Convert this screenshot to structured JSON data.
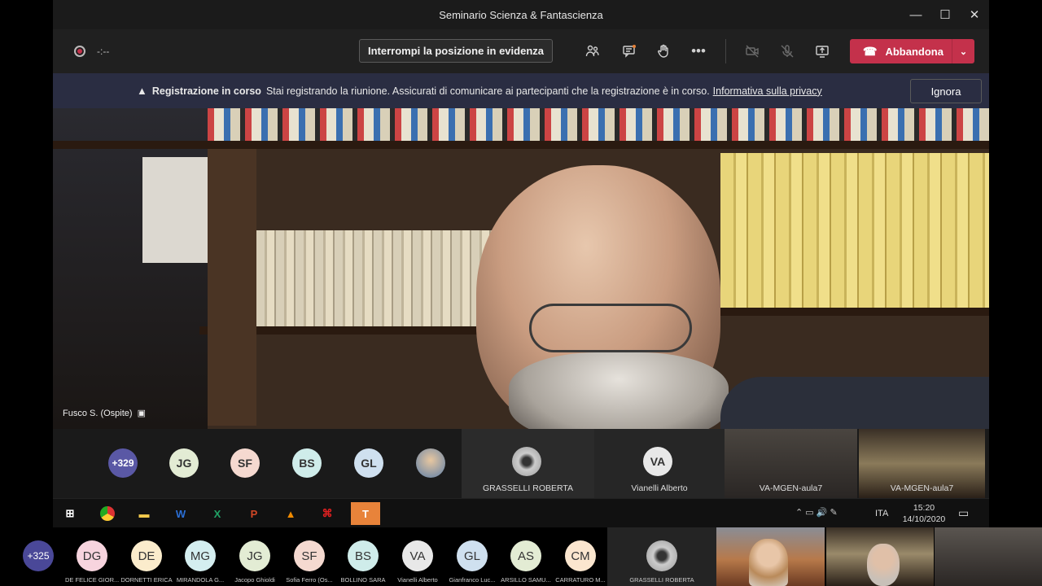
{
  "window": {
    "title": "Seminario Scienza & Fantascienza",
    "minimize": "—",
    "maximize": "☐",
    "close": "✕"
  },
  "toolbar": {
    "rec_time": "-:--",
    "spotlight_label": "Interrompi la posizione in evidenza",
    "leave_label": "Abbandona"
  },
  "banner": {
    "title": "Registrazione in corso",
    "message": "Stai registrando la riunione. Assicurati di comunicare ai partecipanti che la registrazione è in corso.",
    "link": "Informativa sulla privacy",
    "ignore_label": "Ignora"
  },
  "video": {
    "speaker": "Fusco S. (Ospite)"
  },
  "strip": {
    "more": "+329",
    "avatars": [
      {
        "initials": "JG",
        "color": "#e3ecd4"
      },
      {
        "initials": "SF",
        "color": "#f5d9d0"
      },
      {
        "initials": "BS",
        "color": "#cfecea"
      },
      {
        "initials": "GL",
        "color": "#cfe0ef"
      }
    ],
    "tiles": [
      {
        "name": "GRASSELLI ROBERTA"
      },
      {
        "name": "Vianelli Alberto",
        "initials": "VA"
      },
      {
        "name": "VA-MGEN-aula7"
      },
      {
        "name": "VA-MGEN-aula7"
      }
    ]
  },
  "taskbar": {
    "lang": "ITA",
    "time": "15:20",
    "date": "14/10/2020"
  },
  "outer": {
    "more": "+325",
    "people": [
      {
        "initials": "DG",
        "name": "DE FELICE GIOR...",
        "color": "#f7d4de"
      },
      {
        "initials": "DE",
        "name": "DORNETTI ERICA",
        "color": "#fbeccc"
      },
      {
        "initials": "MG",
        "name": "MIRANDOLA G...",
        "color": "#d4eef0"
      },
      {
        "initials": "JG",
        "name": "Jacopo Ghioldi",
        "color": "#e3ecd4"
      },
      {
        "initials": "SF",
        "name": "Sofia Ferro (Os...",
        "color": "#f5d9d0"
      },
      {
        "initials": "BS",
        "name": "BOLLINO SARA",
        "color": "#cfecea"
      },
      {
        "initials": "VA",
        "name": "Vianelli Alberto",
        "color": "#e8e8e8"
      },
      {
        "initials": "GL",
        "name": "Gianfranco Luc...",
        "color": "#cfe0ef"
      },
      {
        "initials": "AS",
        "name": "ARSILLO SAMU...",
        "color": "#e3ecd4"
      },
      {
        "initials": "CM",
        "name": "CARRATURO M...",
        "color": "#fbe6cf"
      }
    ],
    "tile_name": "GRASSELLI ROBERTA"
  }
}
